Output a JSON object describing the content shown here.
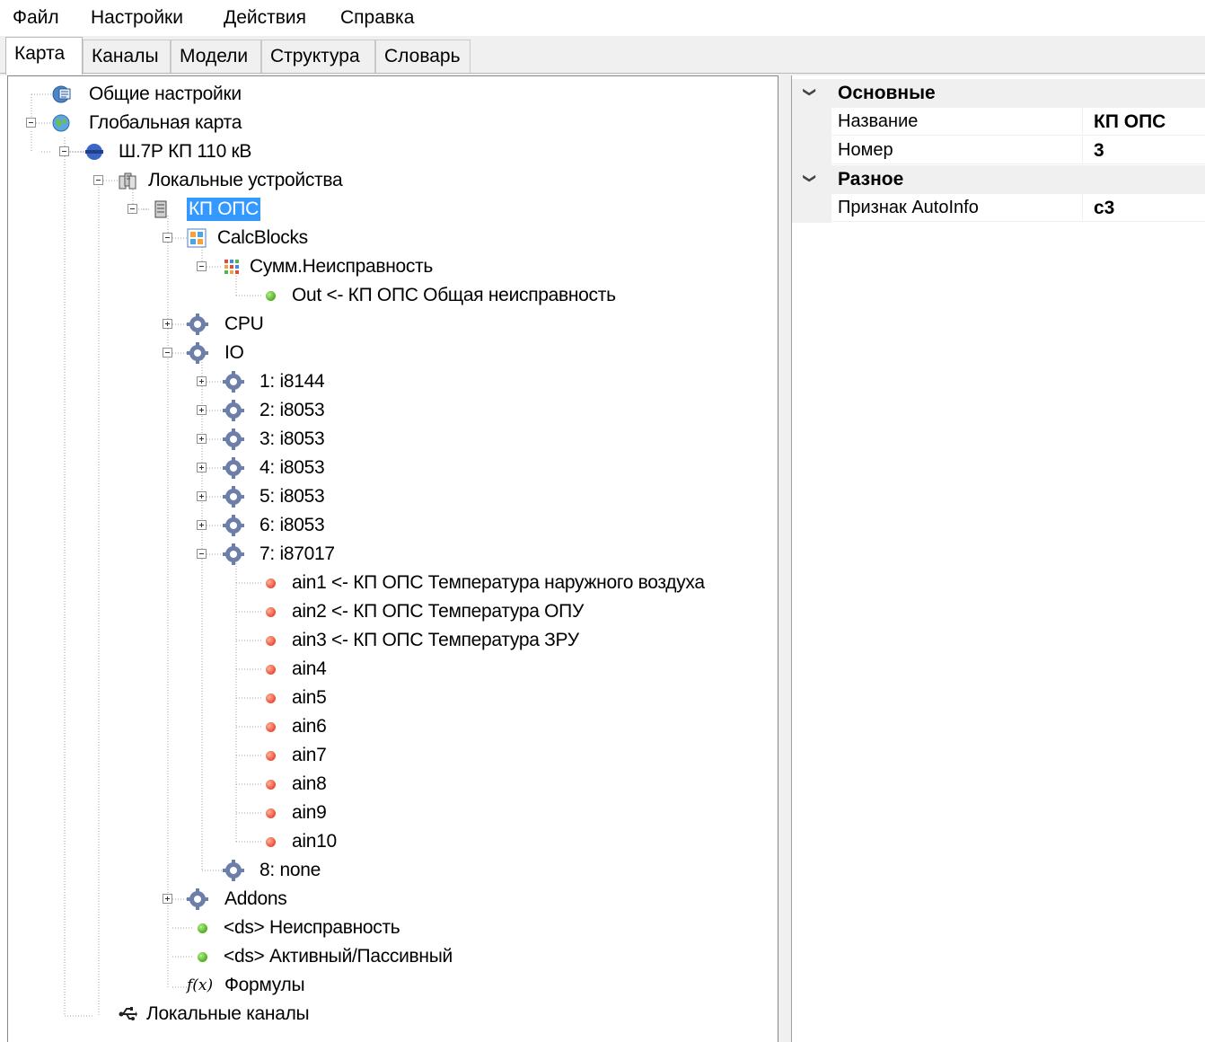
{
  "menu": [
    "Файл",
    "Настройки",
    "Действия",
    "Справка"
  ],
  "tabs": [
    "Карта",
    "Каналы",
    "Модели",
    "Структура",
    "Словарь"
  ],
  "active_tab": "Карта",
  "tree": {
    "general_settings": "Общие настройки",
    "global_map": "Глобальная карта",
    "station": "Ш.7Р КП 110 кВ",
    "local_devices": "Локальные устройства",
    "device": "КП ОПС",
    "calcblocks": "CalcBlocks",
    "summ_fault": "Сумм.Неисправность",
    "out_signal": "Out <- КП ОПС Общая неисправность",
    "cpu": "CPU",
    "io": "IO",
    "modules": [
      "1: i8144",
      "2: i8053",
      "3: i8053",
      "4: i8053",
      "5: i8053",
      "6: i8053",
      "7: i87017"
    ],
    "ain": [
      "ain1 <- КП ОПС Температура наружного воздуха",
      "ain2 <- КП ОПС Температура ОПУ",
      "ain3 <- КП ОПС Температура ЗРУ",
      "ain4",
      "ain5",
      "ain6",
      "ain7",
      "ain8",
      "ain9",
      "ain10"
    ],
    "module8": "8: none",
    "addons": "Addons",
    "ds_fault": "<ds> Неисправность",
    "ds_active": "<ds> Активный/Пассивный",
    "formulas": "Формулы",
    "local_channels": "Локальные каналы"
  },
  "properties": {
    "cat_main": "Основные",
    "name_label": "Название",
    "name_value": "КП ОПС",
    "number_label": "Номер",
    "number_value": "3",
    "cat_misc": "Разное",
    "autoinfo_label": "Признак AutoInfo",
    "autoinfo_value": "c3"
  },
  "colors": {
    "selection": "#3399ff",
    "status_ok": "#59b82a",
    "status_error": "#ef5a3e"
  }
}
